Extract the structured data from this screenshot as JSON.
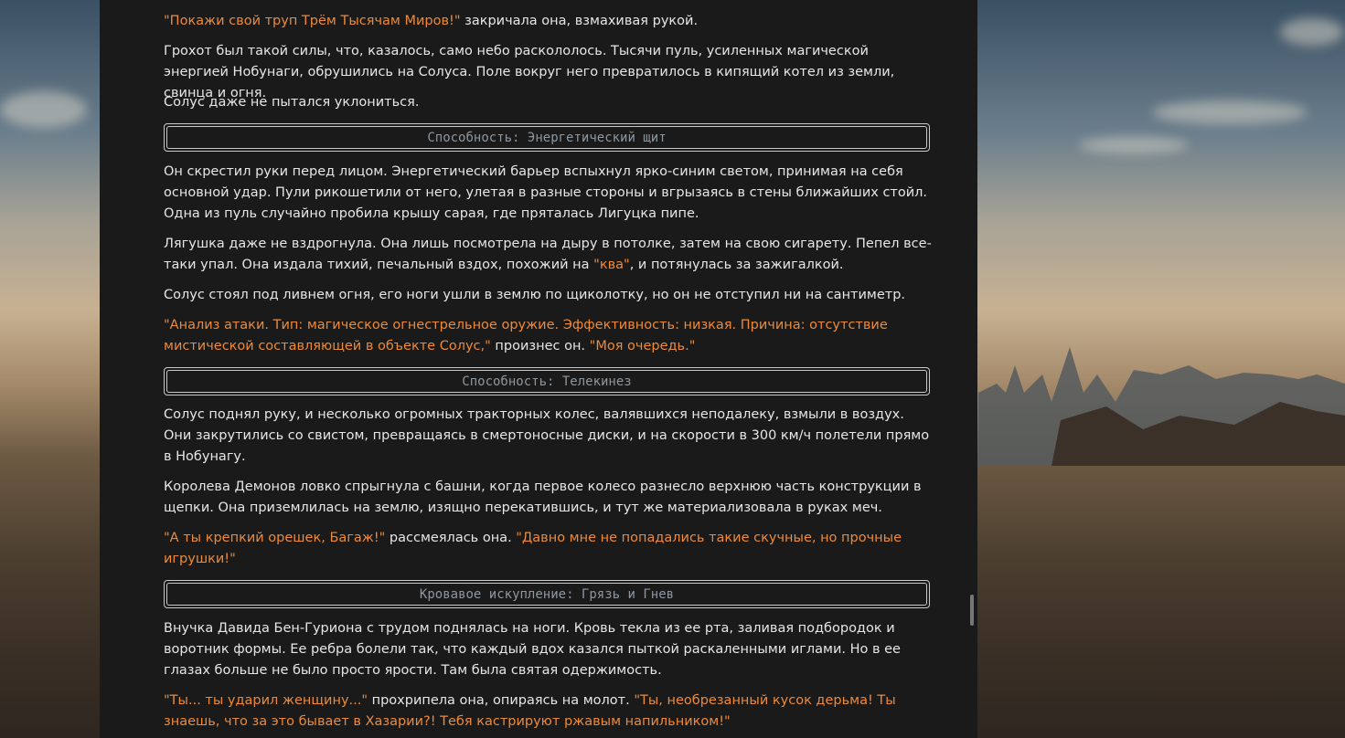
{
  "story": {
    "p1": {
      "q1": "\"Покажи свой труп Трём Тысячам Миров!\"",
      "t1": " закричала она, взмахивая рукой."
    },
    "p2": "Грохот был такой силы, что, казалось, само небо раскололось. Тысячи пуль, усиленных магической энергией Нобунаги, обрушились на Солуса. Поле вокруг него превратилось в кипящий котел из земли, свинца и огня.",
    "p3": "Солус даже не пытался уклониться.",
    "ability1": "Способность: Энергетический щит",
    "p4": "Он скрестил руки перед лицом. Энергетический барьер вспыхнул ярко-синим светом, принимая на себя основной удар. Пули рикошетили от него, улетая в разные стороны и вгрызаясь в стены ближайших стойл. Одна из пуль случайно пробила крышу сарая, где пряталась Лигуцка пипе.",
    "p5": {
      "t1": "Лягушка даже не вздрогнула. Она лишь посмотрела на дыру в потолке, затем на свою сигарету. Пепел все-таки упал. Она издала тихий, печальный вздох, похожий на ",
      "q1": "\"ква\"",
      "t2": ", и потянулась за зажигалкой."
    },
    "p6": "Солус стоял под ливнем огня, его ноги ушли в землю по щиколотку, но он не отступил ни на сантиметр.",
    "p7": {
      "q1": "\"Анализ атаки. Тип: магическое огнестрельное оружие. Эффективность: низкая. Причина: отсутствие мистической составляющей в объекте Солус,\"",
      "t1": " произнес он. ",
      "q2": "\"Моя очередь.\""
    },
    "ability2": "Способность: Телекинез",
    "p8": "Солус поднял руку, и несколько огромных тракторных колес, валявшихся неподалеку, взмыли в воздух. Они закрутились со свистом, превращаясь в смертоносные диски, и на скорости в 300 км/ч полетели прямо в Нобунагу.",
    "p9": "Королева Демонов ловко спрыгнула с башни, когда первое колесо разнесло верхнюю часть конструкции в щепки. Она приземлилась на землю, изящно перекатившись, и тут же материализовала в руках меч.",
    "p10": {
      "q1": "\"А ты крепкий орешек, Багаж!\"",
      "t1": " рассмеялась она. ",
      "q2": "\"Давно мне не попадались такие скучные, но прочные игрушки!\""
    },
    "ability3": "Кровавое искупление: Грязь и Гнев",
    "p11": "Внучка Давида Бен-Гуриона с трудом поднялась на ноги. Кровь текла из ее рта, заливая подбородок и воротник формы. Ее ребра болели так, что каждый вдох казался пыткой раскаленными иглами. Но в ее глазах больше не было просто ярости. Там была святая одержимость.",
    "p12": {
      "q1": "\"Ты... ты ударил женщину...\"",
      "t1": " прохрипела она, опираясь на молот. ",
      "q2": "\"Ты, необрезанный кусок дерьма! Ты знаешь, что за это бывает в Хазарии?! Тебя кастрируют ржавым напильником!\""
    }
  },
  "colors": {
    "panel_bg": "#1a1a1a",
    "text": "#e6e6e6",
    "quote": "#ec8a3a",
    "ability_text": "#8d97a0",
    "ability_border": "#c9c9c9"
  }
}
